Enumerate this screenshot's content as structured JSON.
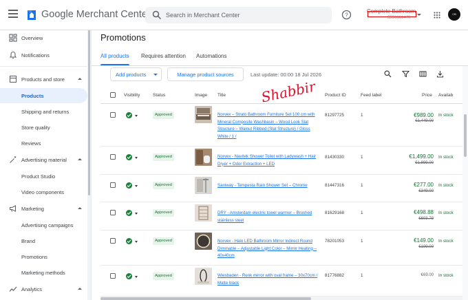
{
  "header": {
    "brand": "Google Merchant Center",
    "search_placeholder": "Search in Merchant Center",
    "account_name": "Complete Bathroom",
    "account_id": "5556661470",
    "avatar_text": "CB"
  },
  "sidebar": {
    "items": [
      {
        "label": "Overview"
      },
      {
        "label": "Notifications"
      },
      {
        "label": "Products and store"
      },
      {
        "label": "Products"
      },
      {
        "label": "Shipping and returns"
      },
      {
        "label": "Store quality"
      },
      {
        "label": "Reviews"
      },
      {
        "label": "Advertising material"
      },
      {
        "label": "Product Studio"
      },
      {
        "label": "Video components"
      },
      {
        "label": "Marketing"
      },
      {
        "label": "Advertising campaigns"
      },
      {
        "label": "Brand"
      },
      {
        "label": "Promotions"
      },
      {
        "label": "Marketing methods"
      },
      {
        "label": "Analytics"
      }
    ]
  },
  "page": {
    "title": "Promotions",
    "tabs": [
      {
        "label": "All products"
      },
      {
        "label": "Requires attention"
      },
      {
        "label": "Automations"
      }
    ]
  },
  "toolbar": {
    "add_products": "Add products",
    "manage_sources": "Manage product sources",
    "last_update": "Last update: 00:00 18 Jul 2026"
  },
  "table": {
    "columns": [
      "Visibility",
      "Status",
      "Image",
      "Title",
      "Product ID",
      "Feed label",
      "Price",
      "Availab"
    ],
    "rows": [
      {
        "status": "Approved",
        "title": "Norvex – Strato Bathroom Furniture Set 100 cm with Mineral Composite Washbasin – Wood Look Slat Structure – Walnut Ribbed (Slat Structure) / Gloss White / 1 /",
        "product_id": "81297725",
        "feed_label": "1",
        "price": "€989.00",
        "price_old": "€1,449.00",
        "availability": "In stock"
      },
      {
        "status": "Approved",
        "title": "Norvex - Navitek Shower Toilet with Ladywash + Hair Dryer + Odor Extraction + LED",
        "product_id": "81430330",
        "feed_label": "1",
        "price": "€1,499.00",
        "price_old": "€1,899.00",
        "availability": "In stock"
      },
      {
        "status": "Approved",
        "title": "Saniway - Tempesta Rain Shower Set – Chrome",
        "product_id": "81447316",
        "feed_label": "1",
        "price": "€277.00",
        "price_old": "€349.00",
        "availability": "In stock"
      },
      {
        "status": "Approved",
        "title": "DRY - Amsterdam electric towel warmer – Brushed stainless steel",
        "product_id": "81629168",
        "feed_label": "1",
        "price": "€498.88",
        "price_old": "€603.79",
        "availability": "In stock"
      },
      {
        "status": "Approved",
        "title": "Norvex - Halo LED Bathroom Mirror Indirect Round Dimmable – Adjustable Light Color – Mirror Heating – 40x40cm",
        "product_id": "78201053",
        "feed_label": "1",
        "price": "€149.00",
        "price_old": "€199.00",
        "availability": "In stock"
      },
      {
        "status": "Approved",
        "title": "Wiesbaden - Renk mirror with oval frame – 30x70cm / Matte black",
        "product_id": "81776882",
        "feed_label": "1",
        "price": "",
        "price_old": "€69.00",
        "availability": "In stock"
      }
    ]
  },
  "annotation": {
    "signature": "Shabbir"
  }
}
